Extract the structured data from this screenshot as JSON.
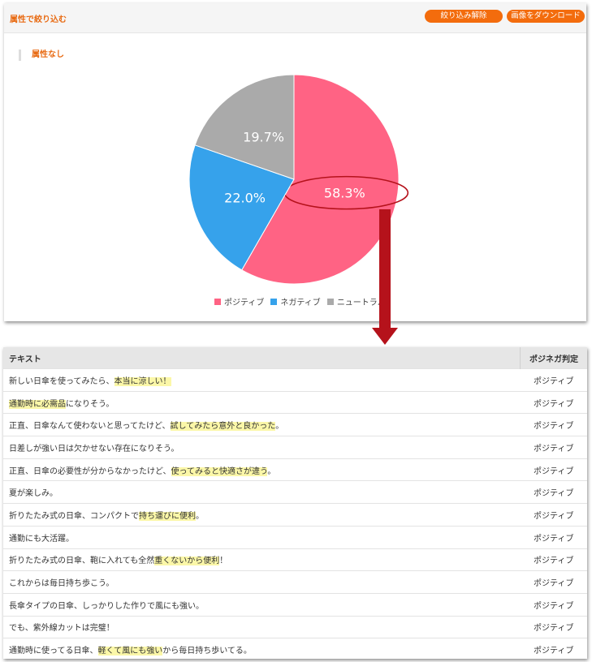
{
  "header": {
    "title": "属性で絞り込む",
    "clear_label": "絞り込み解除",
    "download_label": "画像をダウンロード"
  },
  "attribute_label": "属性なし",
  "chart_data": {
    "type": "pie",
    "slices": [
      {
        "name": "ポジティブ",
        "value": 58.3,
        "label": "58.3%",
        "color": "#ff6384"
      },
      {
        "name": "ネガティブ",
        "value": 22.0,
        "label": "22.0%",
        "color": "#36a2eb"
      },
      {
        "name": "ニュートラル",
        "value": 19.7,
        "label": "19.7%",
        "color": "#aaaaaa"
      }
    ],
    "legend_position": "bottom",
    "highlight": {
      "slice": "ポジティブ",
      "color": "#b5121b"
    }
  },
  "table": {
    "headers": {
      "text": "テキスト",
      "judgement": "ポジネガ判定"
    },
    "rows": [
      {
        "segments": [
          {
            "t": "新しい日傘を使ってみたら、"
          },
          {
            "t": "本当に涼しい！",
            "hl": true
          }
        ],
        "judgement": "ポジティブ"
      },
      {
        "segments": [
          {
            "t": "通勤時に必需品",
            "hl": true
          },
          {
            "t": "になりそう。"
          }
        ],
        "judgement": "ポジティブ"
      },
      {
        "segments": [
          {
            "t": "正直、日傘なんて使わないと思ってたけど、"
          },
          {
            "t": "試してみたら意外と良かった",
            "hl": true
          },
          {
            "t": "。"
          }
        ],
        "judgement": "ポジティブ"
      },
      {
        "segments": [
          {
            "t": "日差しが強い日は欠かせない存在になりそう。"
          }
        ],
        "judgement": "ポジティブ"
      },
      {
        "segments": [
          {
            "t": "正直、日傘の必要性が分からなかったけど、"
          },
          {
            "t": "使ってみると快適さが違う",
            "hl": true
          },
          {
            "t": "。"
          }
        ],
        "judgement": "ポジティブ"
      },
      {
        "segments": [
          {
            "t": "夏が楽しみ。"
          }
        ],
        "judgement": "ポジティブ"
      },
      {
        "segments": [
          {
            "t": "折りたたみ式の日傘、コンパクトで"
          },
          {
            "t": "持ち運びに便利",
            "hl": true
          },
          {
            "t": "。"
          }
        ],
        "judgement": "ポジティブ"
      },
      {
        "segments": [
          {
            "t": "通勤にも大活躍。"
          }
        ],
        "judgement": "ポジティブ"
      },
      {
        "segments": [
          {
            "t": "折りたたみ式の日傘、鞄に入れても全然"
          },
          {
            "t": "重くないから便利",
            "hl": true
          },
          {
            "t": "！"
          }
        ],
        "judgement": "ポジティブ"
      },
      {
        "segments": [
          {
            "t": "これからは毎日持ち歩こう。"
          }
        ],
        "judgement": "ポジティブ"
      },
      {
        "segments": [
          {
            "t": "長傘タイプの日傘、しっかりした作りで風にも強い。"
          }
        ],
        "judgement": "ポジティブ"
      },
      {
        "segments": [
          {
            "t": "でも、紫外線カットは完璧！"
          }
        ],
        "judgement": "ポジティブ"
      },
      {
        "segments": [
          {
            "t": "通勤時に使ってる日傘、"
          },
          {
            "t": "軽くて風にも強い",
            "hl": true
          },
          {
            "t": "から毎日持ち歩いてる。"
          }
        ],
        "judgement": "ポジティブ"
      }
    ]
  }
}
